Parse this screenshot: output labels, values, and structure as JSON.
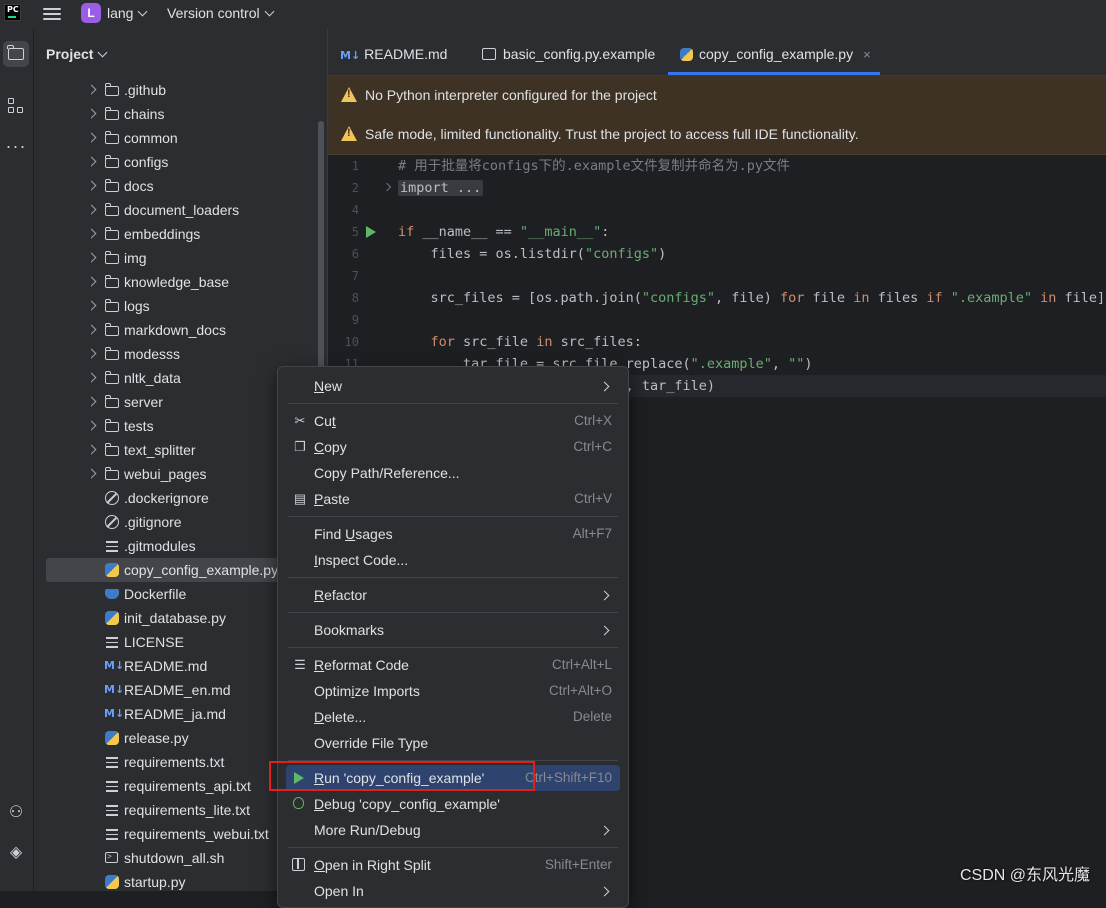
{
  "titlebar": {
    "app_logo_text": "PC",
    "project_badge": "L",
    "project_name": "lang",
    "vcs_label": "Version control"
  },
  "toolstrip": {
    "icons": [
      "folder-icon",
      "structure-icon",
      "more-icon",
      "python-console-icon",
      "layers-icon"
    ]
  },
  "project_panel": {
    "title": "Project",
    "tree": [
      {
        "label": ".github",
        "type": "folder"
      },
      {
        "label": "chains",
        "type": "folder"
      },
      {
        "label": "common",
        "type": "folder"
      },
      {
        "label": "configs",
        "type": "folder"
      },
      {
        "label": "docs",
        "type": "folder"
      },
      {
        "label": "document_loaders",
        "type": "folder"
      },
      {
        "label": "embeddings",
        "type": "folder"
      },
      {
        "label": "img",
        "type": "folder"
      },
      {
        "label": "knowledge_base",
        "type": "folder"
      },
      {
        "label": "logs",
        "type": "folder"
      },
      {
        "label": "markdown_docs",
        "type": "folder"
      },
      {
        "label": "modesss",
        "type": "folder"
      },
      {
        "label": "nltk_data",
        "type": "folder"
      },
      {
        "label": "server",
        "type": "folder"
      },
      {
        "label": "tests",
        "type": "folder"
      },
      {
        "label": "text_splitter",
        "type": "folder"
      },
      {
        "label": "webui_pages",
        "type": "folder"
      },
      {
        "label": ".dockerignore",
        "type": "ignore"
      },
      {
        "label": ".gitignore",
        "type": "ignore"
      },
      {
        "label": ".gitmodules",
        "type": "text"
      },
      {
        "label": "copy_config_example.py",
        "type": "python",
        "selected": true
      },
      {
        "label": "Dockerfile",
        "type": "docker"
      },
      {
        "label": "init_database.py",
        "type": "python"
      },
      {
        "label": "LICENSE",
        "type": "text"
      },
      {
        "label": "README.md",
        "type": "md"
      },
      {
        "label": "README_en.md",
        "type": "md"
      },
      {
        "label": "README_ja.md",
        "type": "md"
      },
      {
        "label": "release.py",
        "type": "python"
      },
      {
        "label": "requirements.txt",
        "type": "text"
      },
      {
        "label": "requirements_api.txt",
        "type": "text"
      },
      {
        "label": "requirements_lite.txt",
        "type": "text"
      },
      {
        "label": "requirements_webui.txt",
        "type": "text"
      },
      {
        "label": "shutdown_all.sh",
        "type": "shell"
      },
      {
        "label": "startup.py",
        "type": "python"
      }
    ]
  },
  "tabs": [
    {
      "label": "README.md",
      "icon": "markdown-icon",
      "prefix": "M↓"
    },
    {
      "label": "basic_config.py.example",
      "icon": "terminal-file-icon"
    },
    {
      "label": "copy_config_example.py",
      "icon": "python-file-icon",
      "active": true,
      "close": "×"
    }
  ],
  "banners": [
    {
      "text": "No Python interpreter configured for the project"
    },
    {
      "text": "Safe mode, limited functionality. Trust the project to access full IDE functionality."
    }
  ],
  "code": {
    "line_numbers": [
      "1",
      "2",
      "4",
      "5",
      "6",
      "7",
      "8",
      "9",
      "10",
      "11"
    ],
    "lines": [
      {
        "n": "1",
        "parts": [
          [
            "cmt",
            "# 用于批量将configs下的.example文件复制并命名为.py文件"
          ]
        ]
      },
      {
        "n": "2",
        "parts": [
          [
            "fold",
            "import ..."
          ]
        ],
        "fold": true
      },
      {
        "n": "4",
        "parts": []
      },
      {
        "n": "5",
        "parts": [
          [
            "kw",
            "if "
          ],
          [
            "",
            "__name__ == "
          ],
          [
            "str",
            "\"__main__\""
          ],
          [
            "",
            ":"
          ]
        ],
        "run": true
      },
      {
        "n": "6",
        "parts": [
          [
            "",
            "    files = os.listdir("
          ],
          [
            "str",
            "\"configs\""
          ],
          [
            "",
            ")"
          ]
        ]
      },
      {
        "n": "7",
        "parts": []
      },
      {
        "n": "8",
        "parts": [
          [
            "",
            "    src_files = [os.path.join("
          ],
          [
            "str",
            "\"configs\""
          ],
          [
            "",
            ", file) "
          ],
          [
            "kw",
            "for "
          ],
          [
            "",
            "file "
          ],
          [
            "kw",
            "in "
          ],
          [
            "",
            "files "
          ],
          [
            "kw",
            "if "
          ],
          [
            "str",
            "\".example\""
          ],
          [
            "kw",
            " in "
          ],
          [
            "",
            "file]"
          ]
        ]
      },
      {
        "n": "9",
        "parts": []
      },
      {
        "n": "10",
        "parts": [
          [
            "",
            "    "
          ],
          [
            "kw",
            "for "
          ],
          [
            "",
            "src_file "
          ],
          [
            "kw",
            "in "
          ],
          [
            "",
            "src_files:"
          ]
        ]
      },
      {
        "n": "11",
        "parts": [
          [
            "",
            "        tar_file = src_file.replace("
          ],
          [
            "str",
            "\".example\""
          ],
          [
            "",
            ", "
          ],
          [
            "str",
            "\"\""
          ],
          [
            "",
            ")"
          ]
        ]
      },
      {
        "n": "",
        "parts": [
          [
            "",
            "        shutil.copy(src_file, tar_file)"
          ]
        ]
      }
    ]
  },
  "context_menu": {
    "items": [
      {
        "label": "New",
        "mnemonic": 0,
        "submenu": true
      },
      {
        "sep": true
      },
      {
        "label": "Cut",
        "mnemonic": 2,
        "key": "Ctrl+X",
        "icon": "scissors-icon",
        "glyph": "✂"
      },
      {
        "label": "Copy",
        "mnemonic": 0,
        "key": "Ctrl+C",
        "icon": "copy-icon",
        "glyph": "❐"
      },
      {
        "label": "Copy Path/Reference..."
      },
      {
        "label": "Paste",
        "mnemonic": 0,
        "key": "Ctrl+V",
        "icon": "paste-icon",
        "glyph": "▤"
      },
      {
        "sep": true
      },
      {
        "label": "Find Usages",
        "mnemonic": 5,
        "key": "Alt+F7"
      },
      {
        "label": "Inspect Code...",
        "mnemonic": 0
      },
      {
        "sep": true
      },
      {
        "label": "Refactor",
        "mnemonic": 0,
        "submenu": true
      },
      {
        "sep": true
      },
      {
        "label": "Bookmarks",
        "submenu": true
      },
      {
        "sep": true
      },
      {
        "label": "Reformat Code",
        "mnemonic": 0,
        "key": "Ctrl+Alt+L",
        "icon": "reformat-icon",
        "glyph": "☰"
      },
      {
        "label": "Optimize Imports",
        "mnemonic": 5,
        "key": "Ctrl+Alt+O"
      },
      {
        "label": "Delete...",
        "mnemonic": 0,
        "key": "Delete"
      },
      {
        "label": "Override File Type"
      },
      {
        "sep": true
      },
      {
        "label": "Run 'copy_config_example'",
        "mnemonic": 0,
        "key": "Ctrl+Shift+F10",
        "icon": "run-icon",
        "highlighted": true
      },
      {
        "label": "Debug 'copy_config_example'",
        "mnemonic": 0,
        "icon": "debug-icon"
      },
      {
        "label": "More Run/Debug",
        "submenu": true
      },
      {
        "sep": true
      },
      {
        "label": "Open in Right Split",
        "mnemonic": 0,
        "key": "Shift+Enter",
        "icon": "split-icon"
      },
      {
        "label": "Open In",
        "submenu": true
      }
    ]
  },
  "watermark": "CSDN @东风光魔",
  "colors": {
    "accent": "#3574f0",
    "warning_bg": "#3d3223",
    "highlight_red": "#e0221f",
    "run_green": "#5fb865"
  }
}
